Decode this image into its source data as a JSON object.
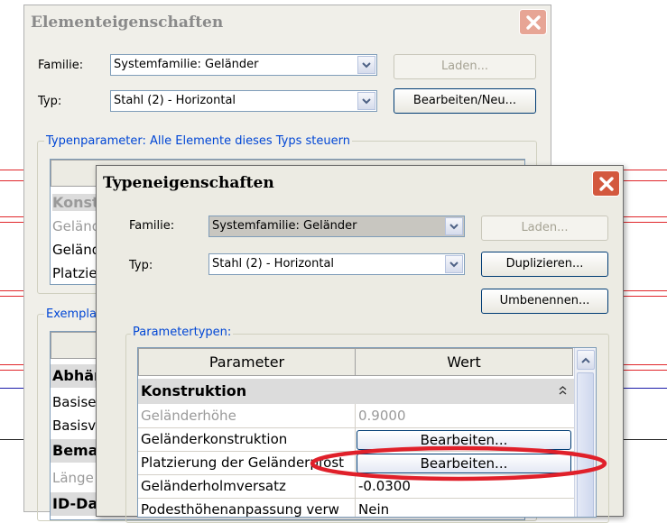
{
  "background_window": {
    "title": "Elementeigenschaften",
    "family_label": "Familie:",
    "family_value": "Systemfamilie: Geländer",
    "type_label": "Typ:",
    "type_value": "Stahl (2) - Horizontal",
    "load_button": "Laden...",
    "edit_new_button": "Bearbeiten/Neu...",
    "type_params_group": "Typenparameter: Alle Elemente dieses Typs steuern",
    "type_params_rows": [
      "Konstr",
      "Geländ",
      "Geländ",
      "Platzie"
    ],
    "instance_group": "Exemplar",
    "instance_rows": [
      "Abhän",
      "Basise",
      "Basisv",
      "Bema",
      "Länge",
      "ID-Da"
    ]
  },
  "dialog": {
    "title": "Typeneigenschaften",
    "family_label": "Familie:",
    "family_value": "Systemfamilie: Geländer",
    "type_label": "Typ:",
    "type_value": "Stahl (2) - Horizontal",
    "load_button": "Laden...",
    "duplicate_button": "Duplizieren...",
    "rename_button": "Umbenennen...",
    "params_group": "Parametertypen:",
    "table": {
      "col_parameter": "Parameter",
      "col_value": "Wert",
      "section": "Konstruktion",
      "rows": [
        {
          "name": "Geländerhöhe",
          "value": "0.9000"
        },
        {
          "name": "Geländerkonstruktion",
          "value": "Bearbeiten..."
        },
        {
          "name": "Platzierung der Geländerpfost",
          "value": "Bearbeiten..."
        },
        {
          "name": "Geländerholmversatz",
          "value": "-0.0300"
        },
        {
          "name": "Podesthöhenanpassung verw",
          "value": "Nein"
        }
      ]
    }
  },
  "colors": {
    "highlight_ellipse": "#e0202a",
    "close_button": "#d3583e",
    "group_title": "#0046d5"
  },
  "icons": [
    "close-icon",
    "chevron-down-icon",
    "collapse-icon",
    "scroll-up-icon"
  ]
}
